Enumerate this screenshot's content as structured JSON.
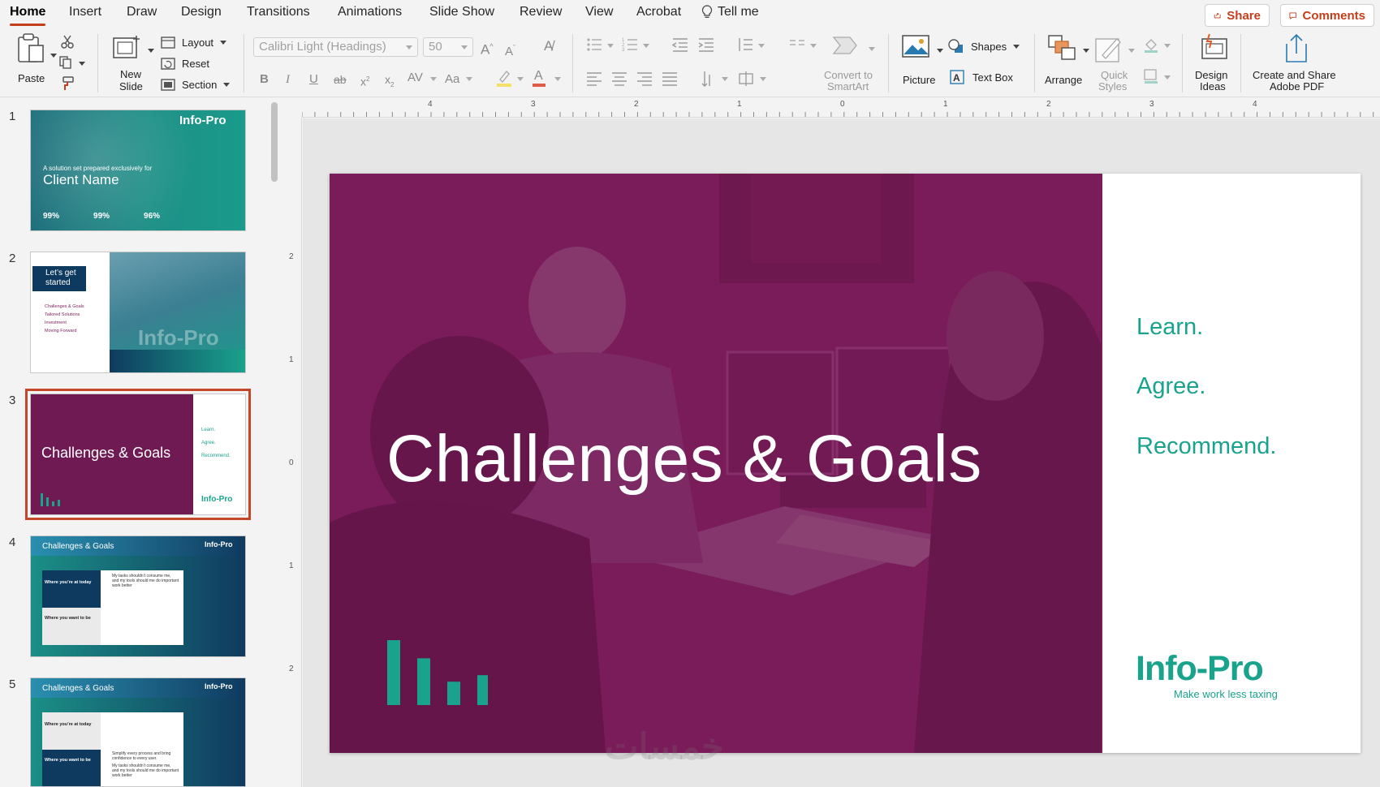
{
  "tabs": [
    {
      "label": "Home",
      "active": true
    },
    {
      "label": "Insert"
    },
    {
      "label": "Draw"
    },
    {
      "label": "Design"
    },
    {
      "label": "Transitions"
    },
    {
      "label": "Animations"
    },
    {
      "label": "Slide Show"
    },
    {
      "label": "Review"
    },
    {
      "label": "View"
    },
    {
      "label": "Acrobat"
    }
  ],
  "tell_me": "Tell me",
  "share_label": "Share",
  "comments_label": "Comments",
  "ribbon": {
    "paste": "Paste",
    "new_slide_line1": "New",
    "new_slide_line2": "Slide",
    "layout": "Layout",
    "reset": "Reset",
    "section": "Section",
    "font_name": "Calibri Light (Headings)",
    "font_size": "50",
    "convert_line1": "Convert to",
    "convert_line2": "SmartArt",
    "picture": "Picture",
    "shapes": "Shapes",
    "text_box": "Text Box",
    "arrange": "Arrange",
    "quick_styles_line1": "Quick",
    "quick_styles_line2": "Styles",
    "design_ideas_line1": "Design",
    "design_ideas_line2": "Ideas",
    "adobe_line1": "Create and Share",
    "adobe_line2": "Adobe PDF"
  },
  "ruler": {
    "h": [
      "4",
      "3",
      "2",
      "1",
      "0",
      "1",
      "2",
      "3",
      "4"
    ],
    "v": [
      "2",
      "1",
      "0",
      "1",
      "2"
    ]
  },
  "thumbnails": [
    {
      "num": "1",
      "sub": "A solution set prepared exclusively for",
      "title": "Client Name",
      "stats": [
        "99%",
        "99%",
        "96%"
      ],
      "logo": "Info-Pro"
    },
    {
      "num": "2",
      "badge_line1": "Let’s get",
      "badge_line2": "started",
      "items": [
        "Challenges & Goals",
        "Tailored Solutions",
        "Investment",
        "Moving Forward"
      ],
      "logo": "Info-Pro"
    },
    {
      "num": "3",
      "title": "Challenges & Goals",
      "items": [
        "Learn.",
        "Agree.",
        "Recommend."
      ],
      "logo": "Info-Pro",
      "selected": true
    },
    {
      "num": "4",
      "title": "Challenges & Goals",
      "box1": "Where you’re at today",
      "box2": "Where you want to be",
      "bullet": "My tasks shouldn’t consume me, and my tools should me do important work better",
      "logo": "Info-Pro"
    },
    {
      "num": "5",
      "title": "Challenges & Goals",
      "box1": "Where you’re at today",
      "box2": "Where you want to be",
      "bullet1": "Simplify every process and bring confidence to every user.",
      "bullet2": "My tasks shouldn’t consume me, and my tools should me do important work better",
      "logo": "Info-Pro"
    }
  ],
  "slide": {
    "title": "Challenges & Goals",
    "keywords": [
      "Learn.",
      "Agree.",
      "Recommend."
    ],
    "logo_text": "Info-Pro",
    "tagline": "Make work less taxing",
    "bar_levels": [
      1.0,
      0.72,
      0.36,
      0.46
    ]
  },
  "colors": {
    "accent": "#c43e1c",
    "slide_overlay": "#7a1c5a",
    "teal": "#1aa38c",
    "navy": "#0f3a5f"
  },
  "watermark": "خمسات"
}
